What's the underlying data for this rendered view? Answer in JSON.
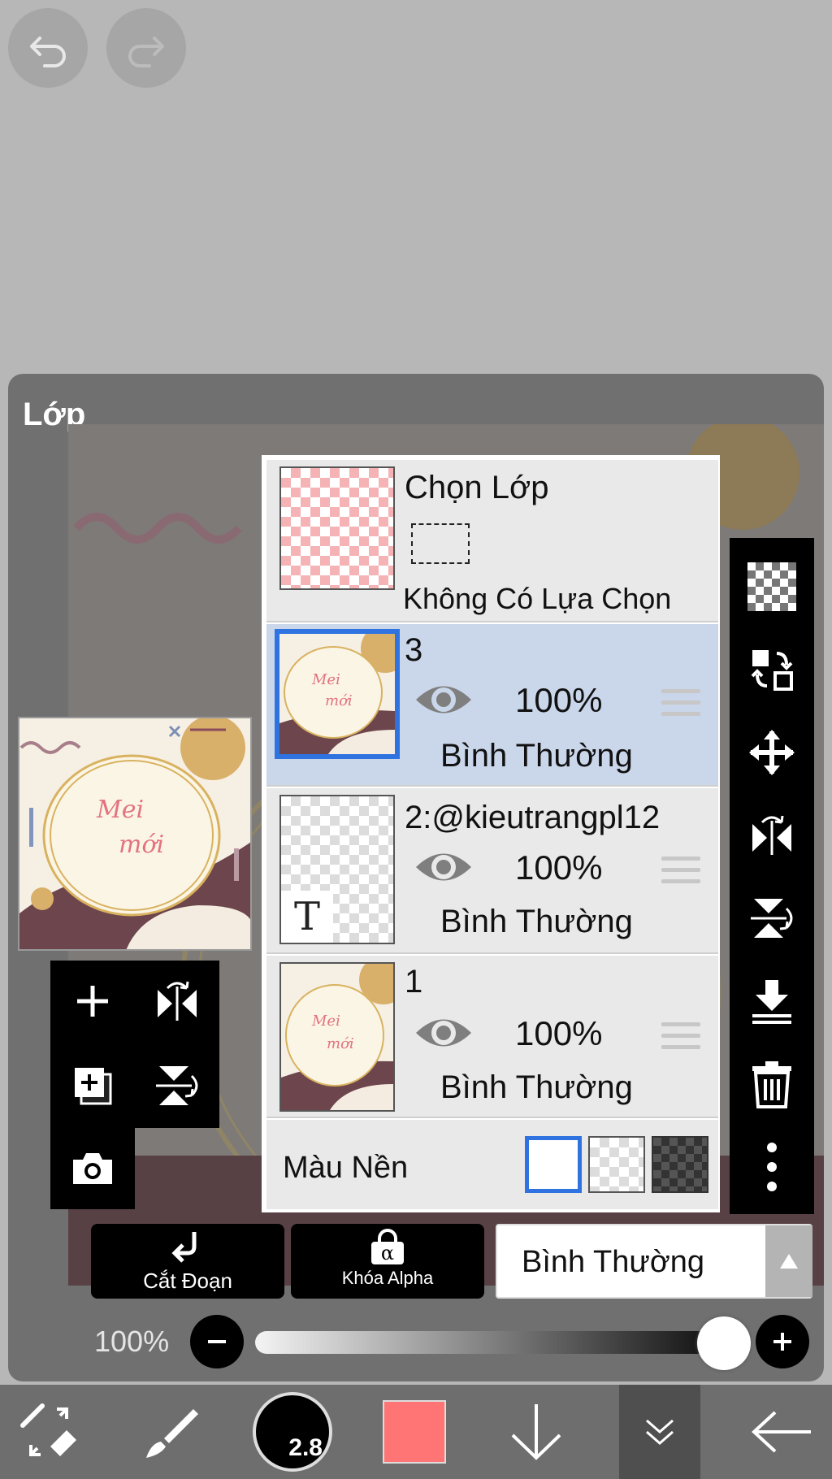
{
  "top_controls": {
    "undo_icon": "undo-icon",
    "redo_icon": "redo-icon"
  },
  "panel": {
    "title": "Lớp"
  },
  "selection_layer": {
    "title": "Chọn Lớp",
    "subtitle": "Không Có Lựa Chọn"
  },
  "layers": [
    {
      "name": "3",
      "opacity": "100%",
      "blend_mode": "Bình Thường",
      "selected": true,
      "thumb_text_1": "Mei",
      "thumb_text_2": "mới"
    },
    {
      "name": "2:@kieutrangpl12",
      "opacity": "100%",
      "blend_mode": "Bình Thường",
      "selected": false,
      "thumb_glyph": "T"
    },
    {
      "name": "1",
      "opacity": "100%",
      "blend_mode": "Bình Thường",
      "selected": false,
      "thumb_text_1": "Mei",
      "thumb_text_2": "mới"
    }
  ],
  "preview": {
    "text_1": "Mei",
    "text_2": "mới"
  },
  "background_color": {
    "label": "Màu Nền",
    "options": [
      "white",
      "transparent",
      "dark-checker"
    ],
    "selected": "white"
  },
  "side_tools": [
    "checker-icon",
    "transfer-icon",
    "move-icon",
    "flip-horizontal-icon",
    "flip-vertical-icon",
    "merge-down-icon",
    "trash-icon",
    "more-icon"
  ],
  "left_tools": [
    "add-layer-icon",
    "flip-h-icon",
    "duplicate-layer-icon",
    "flip-v-icon",
    "camera-icon"
  ],
  "buttons": {
    "clipping_label": "Cắt Đoạn",
    "alpha_lock_label": "Khóa Alpha",
    "alpha_glyph": "α",
    "blend_mode_label": "Bình Thường"
  },
  "opacity_slider": {
    "label": "100%",
    "value": 1.0
  },
  "bottom_toolbar": {
    "brush_size": "2.8",
    "color": "#ff7575"
  },
  "colors": {
    "selected_row": "#cad6ea",
    "accent_blue": "#2f73e0",
    "panel": "#707070"
  }
}
